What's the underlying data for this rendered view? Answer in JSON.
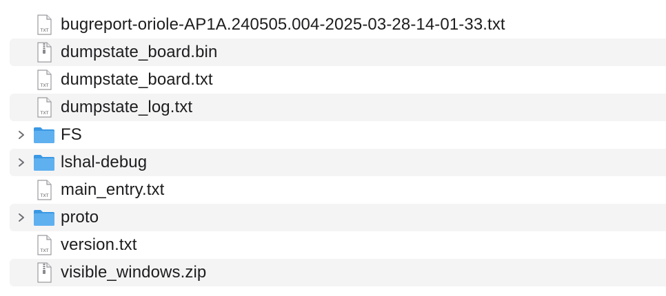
{
  "file_list": {
    "items": [
      {
        "name": "bugreport-oriole-AP1A.240505.004-2025-03-28-14-01-33.txt",
        "kind": "txt-file-icon",
        "expandable": false
      },
      {
        "name": "dumpstate_board.bin",
        "kind": "zip-file-icon",
        "expandable": false
      },
      {
        "name": "dumpstate_board.txt",
        "kind": "txt-file-icon",
        "expandable": false
      },
      {
        "name": "dumpstate_log.txt",
        "kind": "txt-file-icon",
        "expandable": false
      },
      {
        "name": "FS",
        "kind": "folder-icon",
        "expandable": true
      },
      {
        "name": "lshal-debug",
        "kind": "folder-icon",
        "expandable": true
      },
      {
        "name": "main_entry.txt",
        "kind": "txt-file-icon",
        "expandable": false
      },
      {
        "name": "proto",
        "kind": "folder-icon",
        "expandable": true
      },
      {
        "name": "version.txt",
        "kind": "txt-file-icon",
        "expandable": false
      },
      {
        "name": "visible_windows.zip",
        "kind": "zip-file-icon",
        "expandable": false
      }
    ],
    "txt_icon_text": "TXT"
  },
  "colors": {
    "row_alt_bg": "#f4f4f5",
    "folder_blue": "#5fb0ef",
    "folder_blue_dark": "#3a98e4",
    "text": "#1d1d1f",
    "chevron": "#6e6e73"
  }
}
